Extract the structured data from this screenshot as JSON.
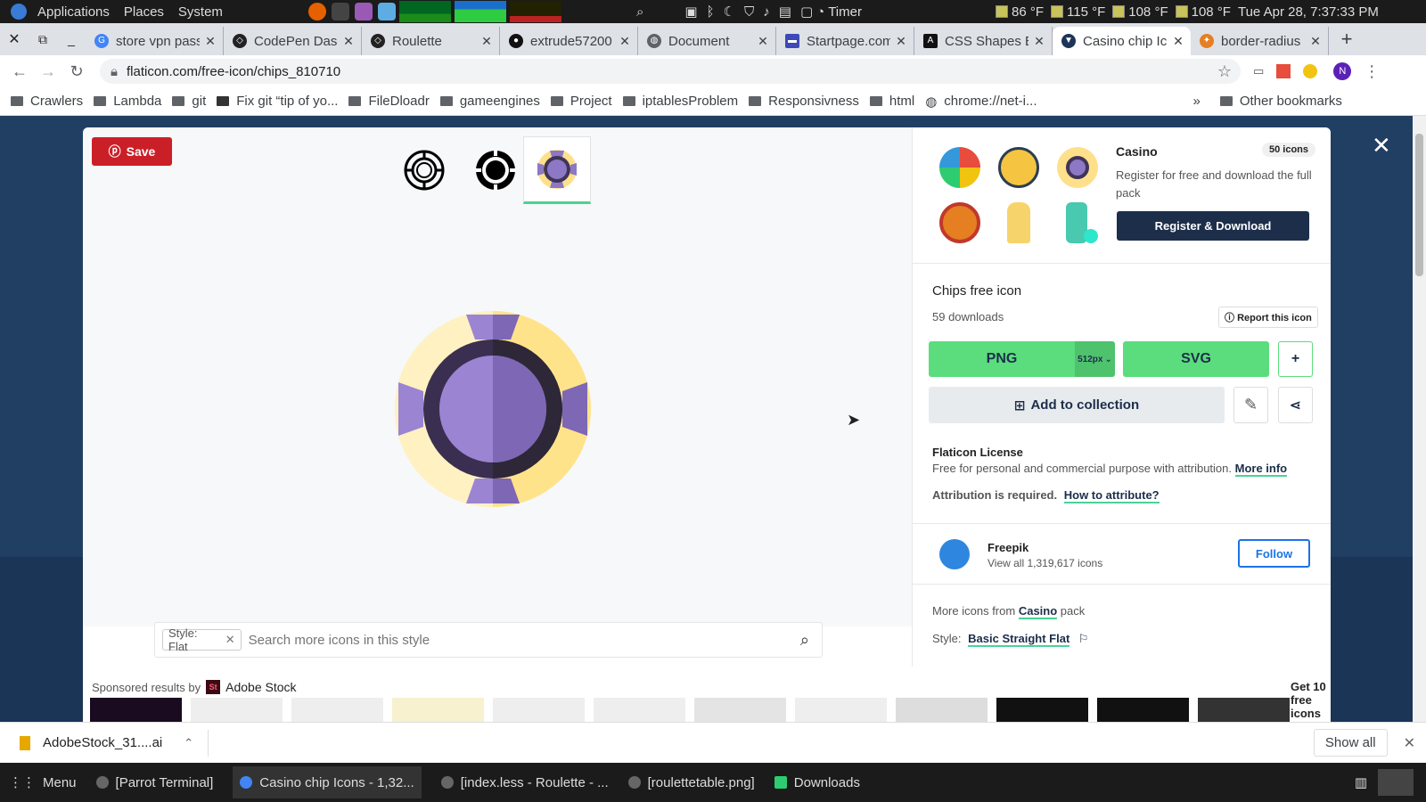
{
  "system": {
    "menu": [
      "Applications",
      "Places",
      "System"
    ],
    "timer": "Timer",
    "temps": [
      "86 °F",
      "115 °F",
      "108 °F",
      "108 °F"
    ],
    "clock": "Tue Apr 28, 7:37:33 PM"
  },
  "tabs": [
    {
      "title": "store vpn pass",
      "icon": "google-icon"
    },
    {
      "title": "CodePen Dash",
      "icon": "codepen-icon"
    },
    {
      "title": "Roulette",
      "icon": "codepen-icon"
    },
    {
      "title": "extrude57200",
      "icon": "github-icon"
    },
    {
      "title": "Document",
      "icon": "globe-icon"
    },
    {
      "title": "Startpage.com",
      "icon": "startpage-icon"
    },
    {
      "title": "CSS Shapes E",
      "icon": "css-icon"
    },
    {
      "title": "Casino chip Ic",
      "icon": "flaticon-icon",
      "active": true
    },
    {
      "title": "border-radius",
      "icon": "css-tricks-icon"
    }
  ],
  "address": {
    "url": "flaticon.com/free-icon/chips_810710"
  },
  "bookmarks": [
    "Crawlers",
    "Lambda",
    "git",
    "Fix git “tip of yo...",
    "FileDloadr",
    "gameengines",
    "Project",
    "iptablesProblem",
    "Responsivness",
    "html",
    "chrome://net-i..."
  ],
  "bookmarks_more": "»",
  "bookmarks_other": "Other bookmarks",
  "modal": {
    "save": "Save",
    "pack": {
      "name": "Casino",
      "count": "50 icons",
      "desc": "Register for free and download the full pack",
      "register": "Register & Download"
    },
    "icon_title": "Chips free icon",
    "downloads": "59 downloads",
    "report": "Report this icon",
    "png": "PNG",
    "png_size": "512px",
    "svg": "SVG",
    "plus": "+",
    "add_collection": "Add to collection",
    "license": {
      "title": "Flaticon License",
      "text": "Free for personal and commercial purpose with attribution.",
      "more": "More info",
      "attribution": "Attribution is required.",
      "how": "How to attribute?"
    },
    "author": {
      "name": "Freepik",
      "sub": "View all 1,319,617 icons",
      "follow": "Follow"
    },
    "more_from": "More icons from",
    "pack_link": "Casino",
    "pack_suffix": "pack",
    "style_label": "Style:",
    "style_link": "Basic Straight Flat",
    "search_chip": "Style: Flat",
    "search_placeholder": "Search more icons in this style",
    "sponsored": "Sponsored results by",
    "adobe": "Adobe Stock",
    "free_icons": "Get 10 free icons"
  },
  "download": {
    "file": "AdobeStock_31....ai",
    "show_all": "Show all"
  },
  "taskbar": {
    "menu": "Menu",
    "items": [
      "[Parrot Terminal]",
      "Casino chip Icons - 1,32...",
      "[index.less - Roulette - ...",
      "[roulettetable.png]",
      "Downloads"
    ]
  }
}
